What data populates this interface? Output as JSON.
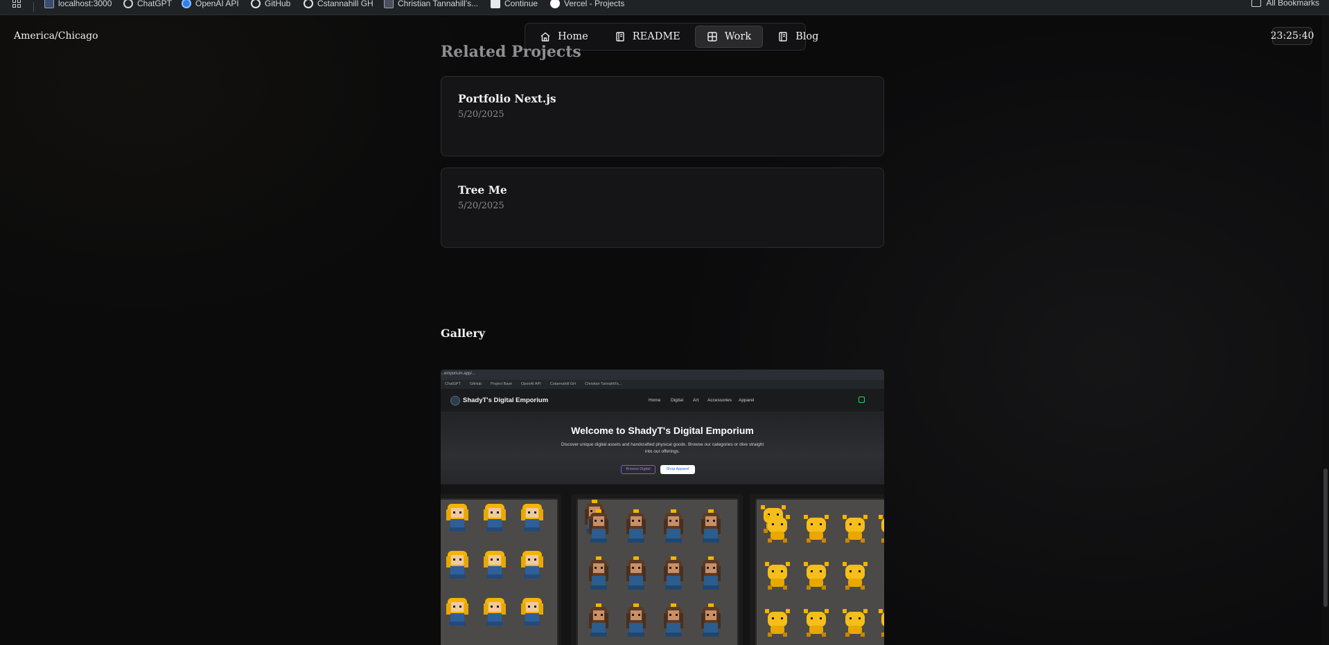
{
  "bookmarks": {
    "items": [
      {
        "label": "localhost:3000",
        "icon": "page-icon"
      },
      {
        "label": "ChatGPT",
        "icon": "openai-icon"
      },
      {
        "label": "OpenAI API",
        "icon": "openai-icon"
      },
      {
        "label": "GitHub",
        "icon": "github-icon"
      },
      {
        "label": "Cstannahill GH",
        "icon": "github-icon"
      },
      {
        "label": "Christian Tannahill's...",
        "icon": "page-icon"
      },
      {
        "label": "Continue",
        "icon": "page-icon"
      },
      {
        "label": "Vercel - Projects",
        "icon": "vercel-icon"
      }
    ],
    "all_bookmarks": "All Bookmarks"
  },
  "header": {
    "timezone": "America/Chicago",
    "clock": "23:25:40",
    "nav": [
      {
        "label": "Home",
        "icon": "home-icon",
        "active": false
      },
      {
        "label": "README",
        "icon": "book-icon",
        "active": false
      },
      {
        "label": "Work",
        "icon": "grid-icon",
        "active": true
      },
      {
        "label": "Blog",
        "icon": "book-icon",
        "active": false
      }
    ]
  },
  "related": {
    "title": "Related Projects",
    "projects": [
      {
        "title": "Portfolio Next.js",
        "date": "5/20/2025"
      },
      {
        "title": "Tree Me",
        "date": "5/20/2025"
      }
    ]
  },
  "gallery": {
    "title": "Gallery",
    "screenshot": {
      "url": "...emporium.app/...",
      "bookmarks": [
        "ChatGPT",
        "GitHub",
        "Project Base",
        "OpenAI API",
        "Cstannahill GH",
        "Christian Tannahill's..."
      ],
      "brand": "ShadyT's Digital Emporium",
      "nav": [
        "Home",
        "Digital",
        "Art",
        "Accessories",
        "Apparel"
      ],
      "hero_title": "Welcome to ShadyT's Digital Emporium",
      "hero_subtitle": "Discover unique digital assets and handcrafted physical goods. Browse our categories or dive straight into our offerings.",
      "button_primary": "Browse Digital",
      "button_secondary": "Shop Apparel"
    }
  },
  "colors": {
    "background": "#0b0b0c",
    "card": "#151517",
    "accent_sprite_gold": "#f4b400",
    "accent_sprite_blue": "#2f5f9a"
  }
}
